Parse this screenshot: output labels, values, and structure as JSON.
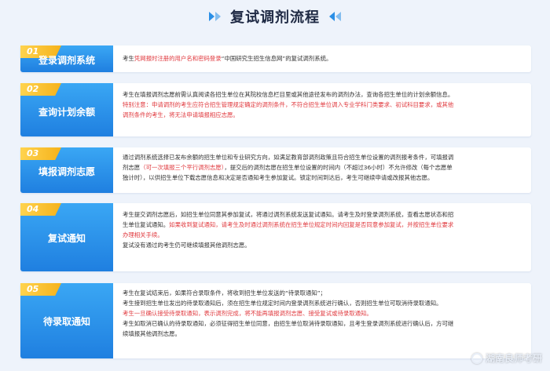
{
  "title": "复试调剂流程",
  "steps": [
    {
      "num": "01",
      "label": "登录调剂系统",
      "lines": [
        [
          {
            "t": "考生"
          },
          {
            "t": "凭网报时注册的用户名和密码登录",
            "red": true
          },
          {
            "t": "“中国研究生招生信息网”的复试调剂系统。"
          }
        ]
      ]
    },
    {
      "num": "02",
      "label": "查询计划余额",
      "lines": [
        [
          {
            "t": "考生在填报调剂志愿前需认真阅读各招生单位在其院校信息栏目里或其他途径发布的调剂办法，查询各招生单位的计划余额信息。"
          }
        ],
        [
          {
            "t": "特别注意：申请调剂的考生应符合招生管理规定确定的调剂条件，不符合招生单位调入专业学科门类要求、初试科目要求，或其他",
            "red": true
          }
        ],
        [
          {
            "t": "调剂条件的考生，将无法申请填报相应志愿。",
            "red": true
          }
        ]
      ]
    },
    {
      "num": "03",
      "label": "填报调剂志愿",
      "lines": [
        [
          {
            "t": "通过调剂系统选择已发布余额的招生单位和专业研究方向，如满足教育部调剂政策且符合招生单位设置的调剂报考条件，可填报调"
          }
        ],
        [
          {
            "t": "剂志愿"
          },
          {
            "t": "（可一次填报三个平行调剂志愿）",
            "red": true
          },
          {
            "t": "，提交后的调剂志愿在招生单位设置的时间内（不超过36小时）不允许修改（每个志愿单"
          }
        ],
        [
          {
            "t": "独计时），以供招生单位下载志愿信息和决定是否通知考生参加复试。锁定时间到达后，考生可继续申请或改报其他志愿。"
          }
        ]
      ]
    },
    {
      "num": "04",
      "label": "复试通知",
      "lines": [
        [
          {
            "t": "考生提交调剂志愿后，如招生单位同意其参加复试，将通过调剂系统发送复试通知。请考生及时登录调剂系统，查看志愿状态和招"
          }
        ],
        [
          {
            "t": "生单位复试通知。"
          },
          {
            "t": "如果收到复试通知，请考生及时通过调剂系统在招生单位规定时间内回复是否同意参加复试，并按招生单位要求",
            "red": true
          }
        ],
        [
          {
            "t": "办理相关手续。",
            "red": true
          }
        ],
        [
          {
            "t": "复试没有通过的考生仍可继续填报其他调剂志愿。"
          }
        ]
      ]
    },
    {
      "num": "05",
      "label": "待录取通知",
      "lines": [
        [
          {
            "t": "考生在复试结束后，如果符合录取条件，将收到招生单位发送的“待录取通知”；"
          }
        ],
        [
          {
            "t": "考生接到招生单位发出的待录取通知后，须在招生单位规定时间内登录调剂系统进行确认，否则招生单位可取消待录取通知。"
          }
        ],
        [
          {
            "t": "考生一旦确认接受待录取通知，表示调剂完成，将不能再填报调剂志愿、接受复试或待录取通知。",
            "red": true
          }
        ],
        [
          {
            "t": "考生如取消已确认的待录取通知，必须征得招生单位同意，由招生单位取消待录取通知，且考生登录调剂系统进行确认后，方可继"
          }
        ],
        [
          {
            "t": "续填报其他调剂志愿。"
          }
        ]
      ]
    }
  ],
  "watermark": "湖南良师考研"
}
